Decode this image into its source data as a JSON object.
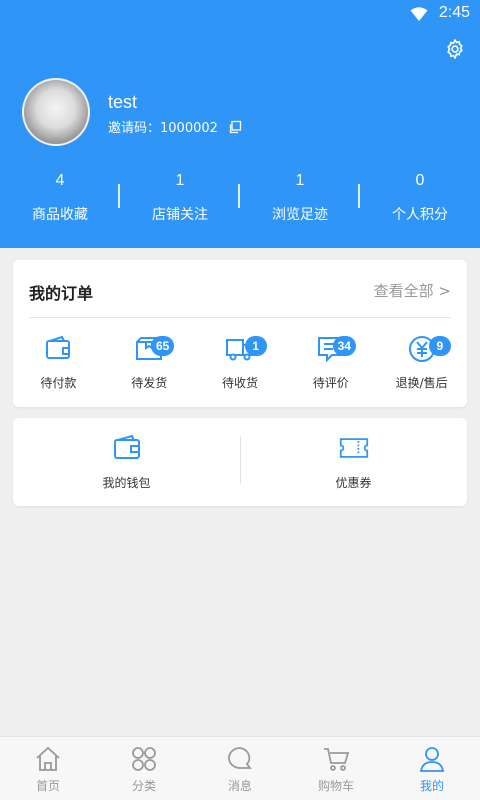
{
  "status_bar": {
    "time": "2:45"
  },
  "profile": {
    "username": "test",
    "invite_code": "邀请码：1000002"
  },
  "stats": [
    {
      "count": "4",
      "label": "商品收藏"
    },
    {
      "count": "1",
      "label": "店铺关注"
    },
    {
      "count": "1",
      "label": "浏览足迹"
    },
    {
      "count": "0",
      "label": "个人积分"
    }
  ],
  "orders": {
    "title": "我的订单",
    "view_all": "查看全部 >",
    "items": [
      {
        "label": "待付款",
        "badge": "",
        "icon": "wallet-icon"
      },
      {
        "label": "待发货",
        "badge": "65",
        "icon": "box-icon"
      },
      {
        "label": "待收货",
        "badge": "1",
        "icon": "truck-icon"
      },
      {
        "label": "待评价",
        "badge": "34",
        "icon": "comment-icon"
      },
      {
        "label": "退换/售后",
        "badge": "9",
        "icon": "refund-yen-icon"
      }
    ]
  },
  "services": [
    {
      "label": "我的钱包",
      "icon": "wallet-icon"
    },
    {
      "label": "优惠券",
      "icon": "coupon-icon"
    }
  ],
  "tabbar": [
    {
      "label": "首页",
      "icon": "home-icon"
    },
    {
      "label": "分类",
      "icon": "category-icon"
    },
    {
      "label": "消息",
      "icon": "message-icon"
    },
    {
      "label": "购物车",
      "icon": "cart-icon"
    },
    {
      "label": "我的",
      "icon": "user-icon"
    }
  ],
  "colors": {
    "primary": "#2f95f7",
    "background": "#efefef"
  }
}
